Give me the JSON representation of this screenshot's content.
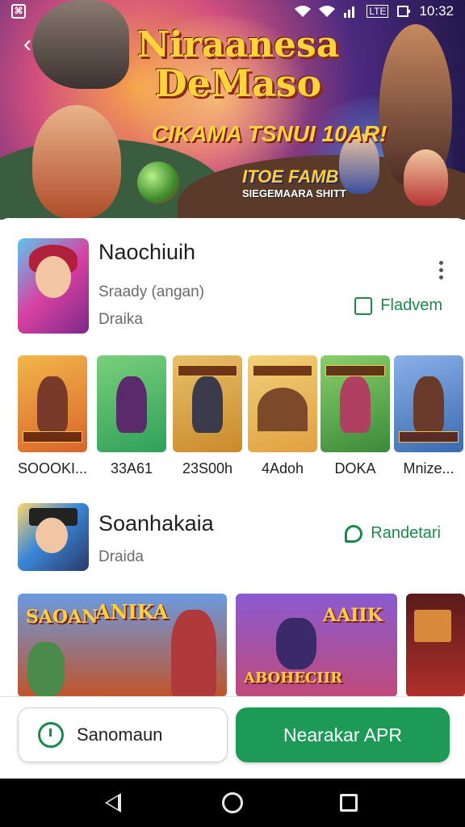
{
  "status_bar": {
    "time": "10:32",
    "network": "LTE"
  },
  "hero": {
    "title_line1": "Niraanesa",
    "title_line2": "DeMaso",
    "subtitle": "CIKAMA TSNUI 10AR!",
    "tag_line1": "ITOE FAMB",
    "tag_line2": "SIEGEMAARA SHITT"
  },
  "app1": {
    "name": "Naochiuih",
    "developer": "Sraady (angan)",
    "category": "Draika",
    "action_label": "Fladvem"
  },
  "thumbnails": [
    {
      "caption": "SOOOKI...",
      "color": "#d8652a",
      "figure": "#7a3a2a"
    },
    {
      "caption": "33A61",
      "color": "#2fa05a",
      "figure": "#5a2a6a"
    },
    {
      "caption": "23S00h",
      "color": "#c98a2a",
      "figure": "#3a3a4a"
    },
    {
      "caption": "4Adoh",
      "color": "#e0a040",
      "figure": "#7a4a2a"
    },
    {
      "caption": "DOKA",
      "color": "#3a8a3a",
      "figure": "#b04060"
    },
    {
      "caption": "Mnize...",
      "color": "#3a6ab0",
      "figure": "#6a3a2a"
    }
  ],
  "app2": {
    "name": "Soanhakaia",
    "category": "Draida",
    "action_label": "Randetari"
  },
  "screenshots": [
    {
      "label": "SAOAN",
      "label2": "ANIKA",
      "bg1": "#3a6ab0",
      "bg2": "#c0542a"
    },
    {
      "label": "AAIIK",
      "label2": "ABOHECIIR",
      "bg1": "#6a3ab0",
      "bg2": "#c04a7a"
    },
    {
      "label": "",
      "label2": "",
      "bg1": "#5a1a1a",
      "bg2": "#b0302a"
    }
  ],
  "buttons": {
    "secondary_label": "Sanomaun",
    "primary_label": "Nearakar APR"
  }
}
